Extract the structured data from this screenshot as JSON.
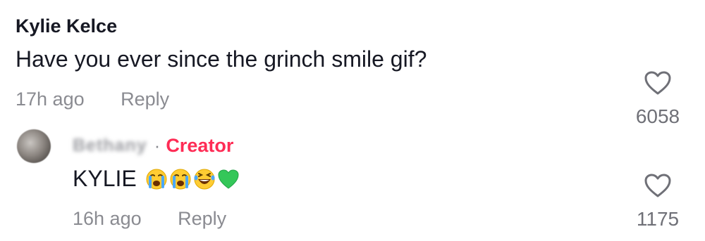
{
  "comments": [
    {
      "author": "Kylie Kelce",
      "text": "Have you ever since the grinch smile gif?",
      "time": "17h ago",
      "reply_label": "Reply",
      "like_count": "6058",
      "like_icon": "heart-outline-icon"
    },
    {
      "author_blurred": "Bethany",
      "separator": "·",
      "badge": "Creator",
      "badge_color": "#fe2c55",
      "text": "KYLIE",
      "emojis": [
        "loudly-crying-face",
        "loudly-crying-face",
        "rolling-laughing-face",
        "green-heart"
      ],
      "time": "16h ago",
      "reply_label": "Reply",
      "like_count": "1175",
      "like_icon": "heart-outline-icon"
    }
  ]
}
